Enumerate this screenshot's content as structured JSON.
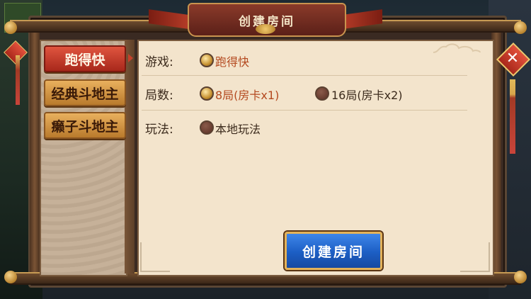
{
  "window": {
    "title": "创建房间"
  },
  "tabs": [
    {
      "label": "跑得快",
      "active": true
    },
    {
      "label": "经典斗地主",
      "active": false
    },
    {
      "label": "癞子斗地主",
      "active": false
    }
  ],
  "rows": {
    "game": {
      "label": "游戏:",
      "options": [
        {
          "text": "跑得快",
          "selected": true
        }
      ]
    },
    "rounds": {
      "label": "局数:",
      "options": [
        {
          "text": "8局(房卡x1)",
          "selected": true
        },
        {
          "text": "16局(房卡x2)",
          "selected": false
        }
      ]
    },
    "rules": {
      "label": "玩法:",
      "options": [
        {
          "text": "本地玩法",
          "selected": false
        }
      ]
    }
  },
  "create_button": {
    "label": "创建房间"
  },
  "close_button": {
    "glyph": "✕"
  },
  "colors": {
    "accent_red": "#c4412b",
    "button_blue": "#1c5ec4",
    "panel_bg": "#f3e4cc",
    "selected_text": "#b4491f"
  },
  "icons": [
    "close-icon",
    "radio-icon",
    "cloud-ornament-icon",
    "tassel-icon"
  ]
}
